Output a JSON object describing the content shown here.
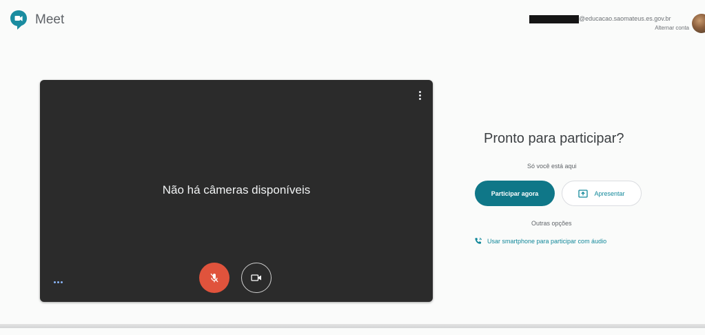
{
  "app": {
    "title": "Meet",
    "brand_color": "#0f9d58"
  },
  "account": {
    "email_suffix": "@educacao.saomateus.es.gov.br",
    "switch_label": "Alternar conta"
  },
  "preview": {
    "no_camera_text": "Não há câmeras disponíveis",
    "mic_state": "off",
    "camera_state": "off"
  },
  "join_panel": {
    "title": "Pronto para participar?",
    "participants_text": "Só você está aqui",
    "join_label": "Participar agora",
    "present_label": "Apresentar",
    "other_options_label": "Outras opções",
    "phone_label": "Usar smartphone para participar com áudio",
    "accent_color": "#0f7788"
  },
  "icons": [
    "meet-logo-icon",
    "more-vert-icon",
    "mic-off-icon",
    "camera-icon",
    "more-horiz-icon",
    "present-icon",
    "phone-icon"
  ]
}
